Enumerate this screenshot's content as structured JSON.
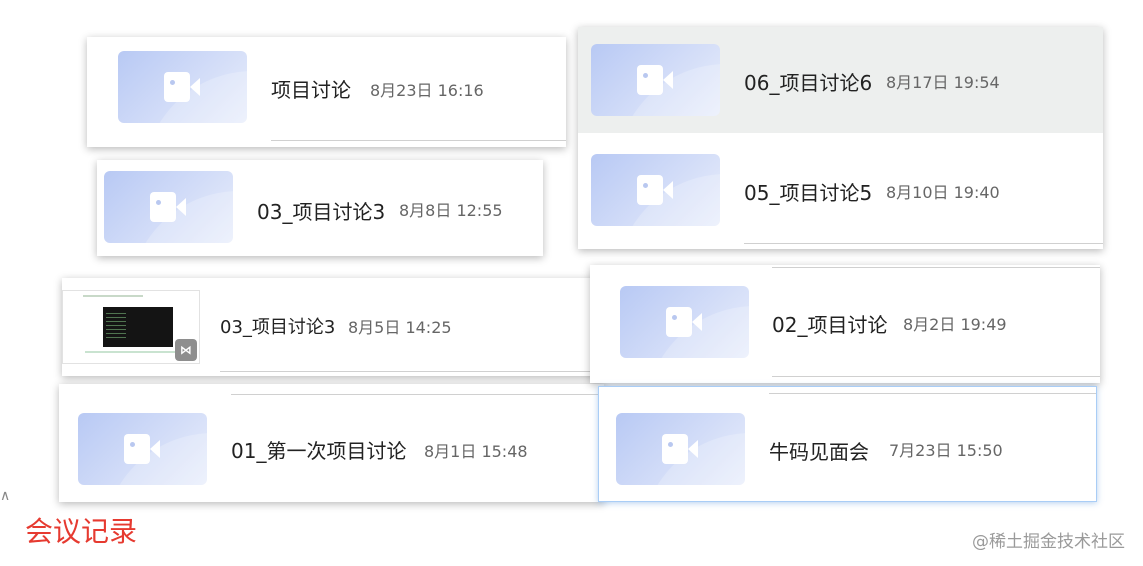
{
  "meetings": [
    {
      "title": "项目讨论",
      "time": "8月23日 16:16"
    },
    {
      "title": "03_项目讨论3",
      "time": "8月8日 12:55"
    },
    {
      "title": "03_项目讨论3",
      "time": "8月5日 14:25"
    },
    {
      "title": "01_第一次项目讨论",
      "time": "8月1日 15:48"
    },
    {
      "title": "06_项目讨论6",
      "time": "8月17日 19:54"
    },
    {
      "title": "05_项目讨论5",
      "time": "8月10日 19:40"
    },
    {
      "title": "02_项目讨论",
      "time": "8月2日 19:49"
    },
    {
      "title": "牛码见面会",
      "time": "7月23日 15:50"
    }
  ],
  "caption": "会议记录",
  "watermark": "@稀土掘金技术社区",
  "badge_icon": "app-logo-icon",
  "thumbnail_icon": "video-camera-icon",
  "colors": {
    "caption": "#e63a30",
    "highlight": "#edefee",
    "selected_border": "#a9cdf6"
  }
}
